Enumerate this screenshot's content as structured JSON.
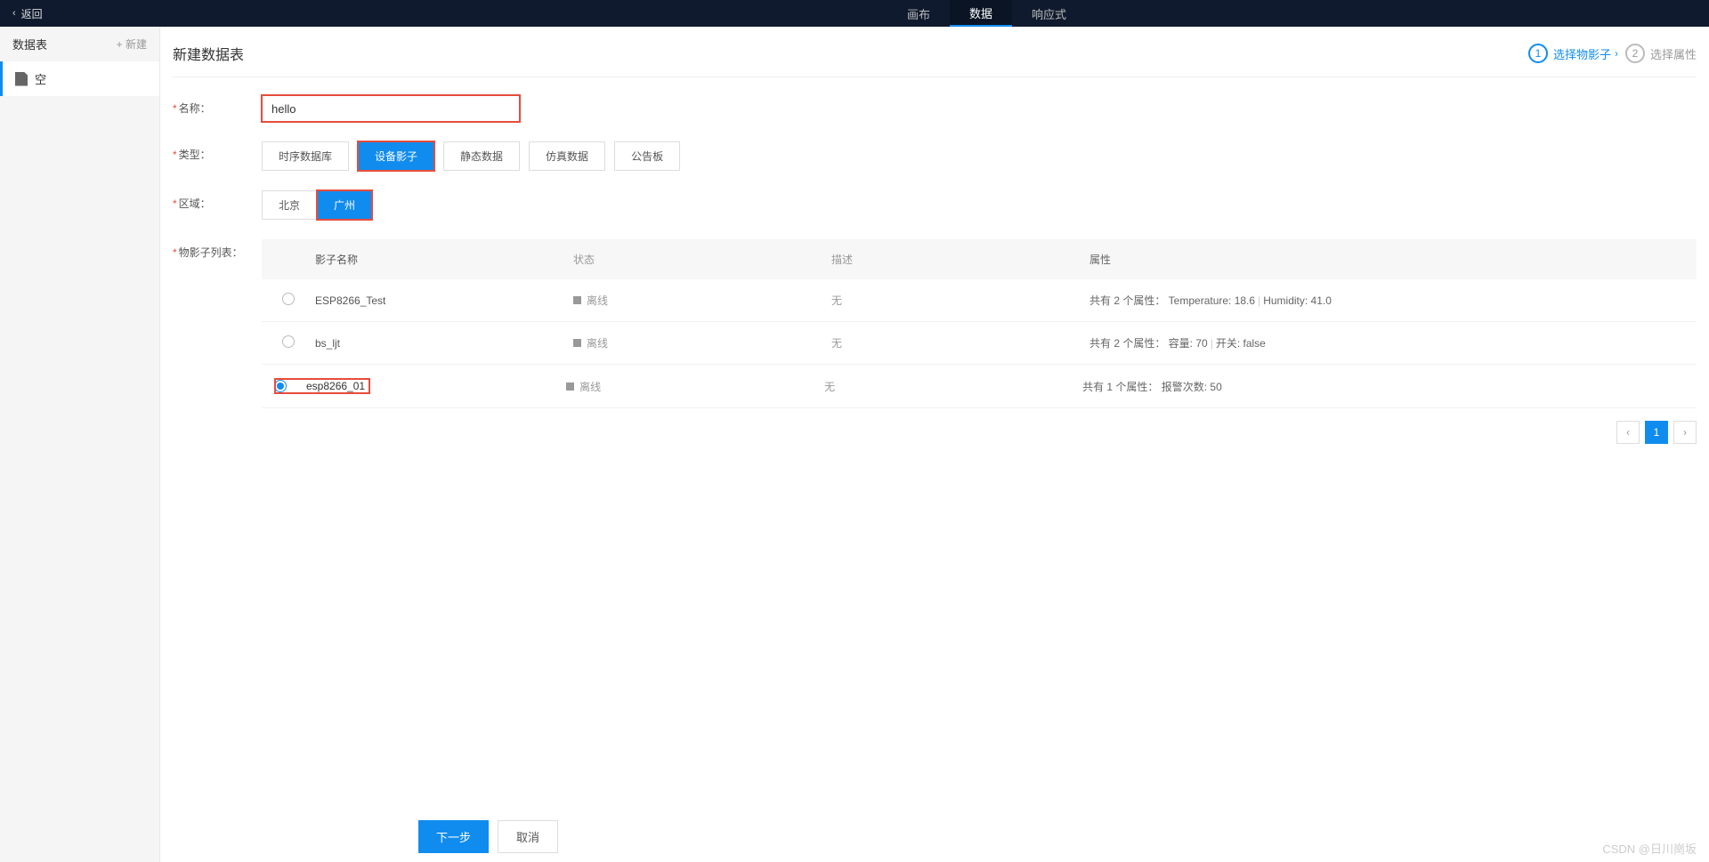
{
  "topnav": {
    "back": "返回",
    "tabs": [
      "画布",
      "数据",
      "响应式"
    ],
    "active": 1
  },
  "sidebar": {
    "title": "数据表",
    "new": "+ 新建",
    "items": [
      {
        "label": "空"
      }
    ]
  },
  "header": {
    "title": "新建数据表",
    "steps": [
      {
        "num": "1",
        "label": "选择物影子"
      },
      {
        "num": "2",
        "label": "选择属性"
      }
    ]
  },
  "form": {
    "name_label": "名称：",
    "name_value": "hello",
    "type_label": "类型：",
    "type_options": [
      "时序数据库",
      "设备影子",
      "静态数据",
      "仿真数据",
      "公告板"
    ],
    "type_active": 1,
    "region_label": "区域：",
    "region_options": [
      "北京",
      "广州"
    ],
    "region_active": 1,
    "list_label": "物影子列表："
  },
  "table": {
    "headers": {
      "name": "影子名称",
      "status": "状态",
      "desc": "描述",
      "attr": "属性"
    },
    "rows": [
      {
        "selected": false,
        "name": "ESP8266_Test",
        "status": "离线",
        "desc": "无",
        "attr_prefix": "共有 2 个属性：",
        "attr_items": [
          "Temperature: 18.6",
          "Humidity: 41.0"
        ]
      },
      {
        "selected": false,
        "name": "bs_ljt",
        "status": "离线",
        "desc": "无",
        "attr_prefix": "共有 2 个属性：",
        "attr_items": [
          "容量: 70",
          "开关: false"
        ]
      },
      {
        "selected": true,
        "name": "esp8266_01",
        "status": "离线",
        "desc": "无",
        "attr_prefix": "共有 1 个属性：",
        "attr_items": [
          "报警次数: 50"
        ]
      }
    ]
  },
  "pagination": {
    "prev": "‹",
    "page": "1",
    "next": "›"
  },
  "footer": {
    "next": "下一步",
    "cancel": "取消"
  },
  "watermark": "CSDN @日川崗坂"
}
